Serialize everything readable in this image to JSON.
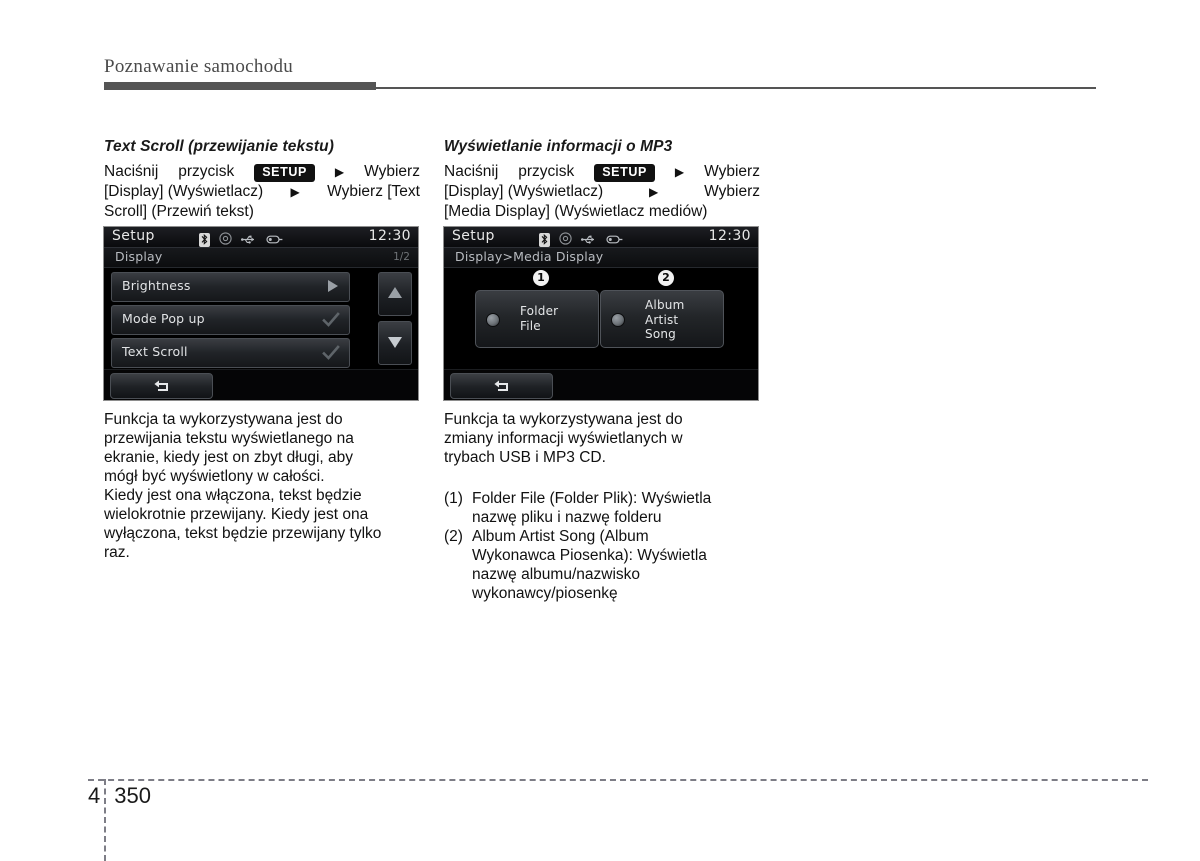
{
  "page": {
    "running_head": "Poznawanie samochodu",
    "chapter_number": "4",
    "page_number": "350"
  },
  "left_column": {
    "heading": "Text Scroll (przewijanie tekstu)",
    "lead": {
      "l1_before": "Naciśnij",
      "l1_word2": "przycisk",
      "setup_chip": "SETUP",
      "l1_after": "Wybierz",
      "l2": "[Display] (Wyświetlacz)",
      "l2_after": "Wybierz [Text",
      "l3": "Scroll] (Przewiń tekst)",
      "arrow": "▶"
    },
    "screenshot": {
      "title": "Setup",
      "clock": "12:30",
      "subtitle": "Display",
      "page_indicator": "1/2",
      "icons": [
        "bluetooth-icon",
        "disc-icon",
        "usb-icon",
        "ipod-icon"
      ],
      "rows": [
        {
          "label": "Brightness",
          "control": "arrow"
        },
        {
          "label": "Mode Pop up",
          "control": "check"
        },
        {
          "label": "Text Scroll",
          "control": "check"
        }
      ],
      "scroll_up": "▲",
      "scroll_down": "▼",
      "back_glyph": "↰"
    },
    "body_paragraphs": [
      {
        "lines": [
          "Funkcja ta wykorzystywana jest do",
          "przewijania tekstu wyświetlanego na",
          "ekranie, kiedy jest on zbyt długi, aby",
          "mógł być wyświetlony w całości."
        ]
      },
      {
        "lines": [
          "Kiedy jest ona włączona, tekst będzie",
          "wielokrotnie przewijany. Kiedy jest ona",
          "wyłączona, tekst będzie przewijany tylko",
          "raz."
        ]
      }
    ]
  },
  "right_column": {
    "heading": "Wyświetlanie informacji o MP3",
    "lead": {
      "l1_before": "Naciśnij",
      "l1_word2": "przycisk",
      "setup_chip": "SETUP",
      "l1_after": "Wybierz",
      "l2": "[Display]   (Wyświetlacz)",
      "l2_after": "Wybierz",
      "l3": "[Media Display] (Wyświetlacz mediów)",
      "arrow": "▶"
    },
    "screenshot": {
      "title": "Setup",
      "clock": "12:30",
      "subtitle": "Display>Media Display",
      "icons": [
        "bluetooth-icon",
        "disc-icon",
        "usb-icon",
        "ipod-icon"
      ],
      "options": [
        {
          "number": "❶",
          "lines": [
            "Folder",
            "File"
          ]
        },
        {
          "number": "❷",
          "lines": [
            "Album",
            "Artist",
            "Song"
          ]
        }
      ],
      "back_glyph": "↰"
    },
    "body_paragraphs": [
      {
        "lines": [
          "Funkcja ta wykorzystywana jest do",
          "zmiany informacji wyświetlanych w",
          "trybach USB i MP3 CD."
        ]
      }
    ],
    "numbered_items": [
      {
        "marker": "(1)",
        "lines": [
          "Folder  File  (Folder  Plik):  Wyświetla",
          "nazwę pliku i nazwę folderu"
        ]
      },
      {
        "marker": "(2)",
        "lines": [
          "Album     Artist     Song     (Album",
          "Wykonawca  Piosenka):  Wyświetla",
          "nazwę                 albumu/nazwisko",
          "wykonawcy/piosenkę"
        ]
      }
    ]
  },
  "colors": {
    "rule": "#555555",
    "screen_bg": "#000000",
    "screen_text": "#e4e6e8",
    "accent_check": "#5e6469"
  }
}
